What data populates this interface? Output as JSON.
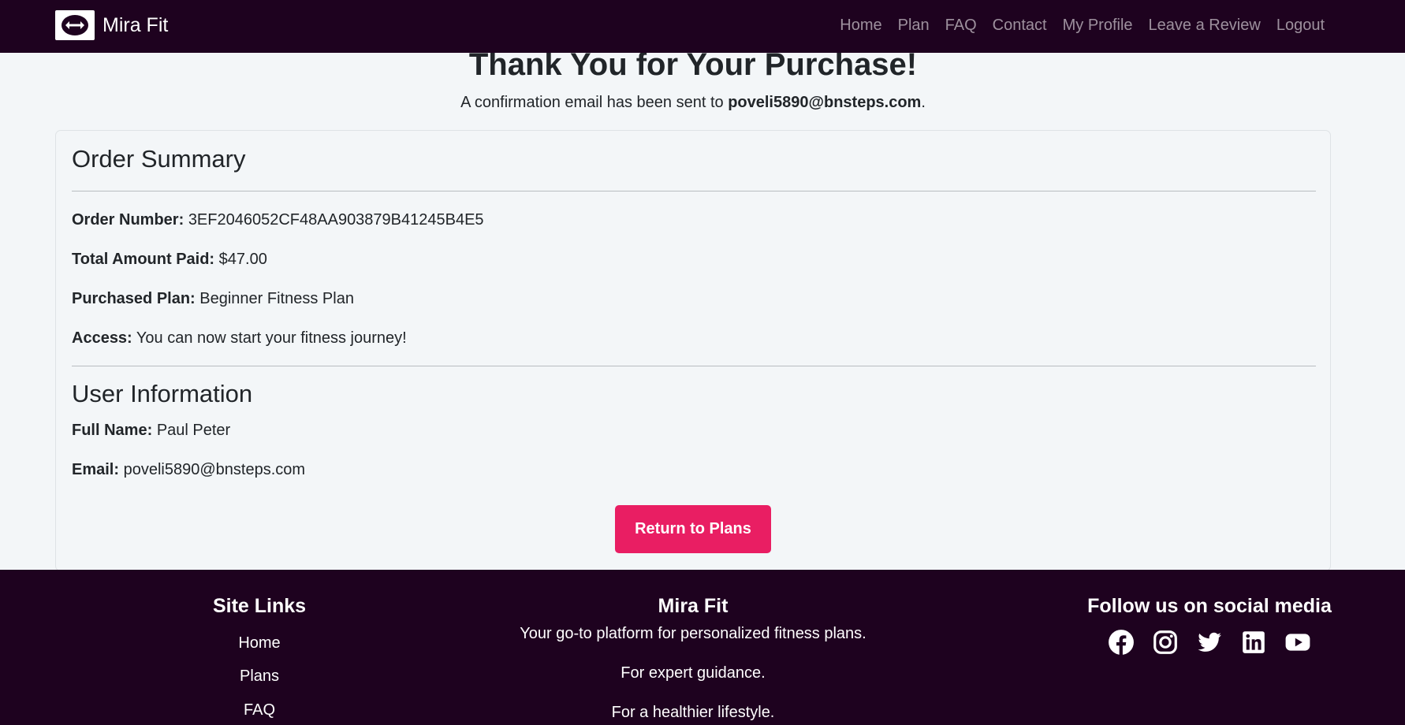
{
  "navbar": {
    "brand": "Mira Fit",
    "links": [
      "Home",
      "Plan",
      "FAQ",
      "Contact",
      "My Profile",
      "Leave a Review",
      "Logout"
    ]
  },
  "main": {
    "title": "Thank You for Your Purchase!",
    "confirm_prefix": "A confirmation email has been sent to ",
    "confirm_email": "poveli5890@bnsteps.com",
    "confirm_suffix": "."
  },
  "order": {
    "heading": "Order Summary",
    "number_label": "Order Number:",
    "number_value": "3EF2046052CF48AA903879B41245B4E5",
    "total_label": "Total Amount Paid:",
    "total_value": "$47.00",
    "plan_label": "Purchased Plan:",
    "plan_value": "Beginner Fitness Plan",
    "access_label": "Access:",
    "access_value": "You can now start your fitness journey!"
  },
  "user": {
    "heading": "User Information",
    "name_label": "Full Name:",
    "name_value": "Paul Peter",
    "email_label": "Email:",
    "email_value": "poveli5890@bnsteps.com"
  },
  "return_button": "Return to Plans",
  "footer": {
    "links_heading": "Site Links",
    "links": [
      "Home",
      "Plans",
      "FAQ"
    ],
    "brand_heading": "Mira Fit",
    "tagline_1": "Your go-to platform for personalized fitness plans.",
    "tagline_2": "For expert guidance.",
    "tagline_3": "For a healthier lifestyle.",
    "social_heading": "Follow us on social media",
    "social_icons": [
      "facebook-icon",
      "instagram-icon",
      "twitter-icon",
      "linkedin-icon",
      "youtube-icon"
    ]
  },
  "colors": {
    "nav_bg": "#1e021f",
    "page_bg": "#f3f6f8",
    "accent": "#e91e63"
  }
}
